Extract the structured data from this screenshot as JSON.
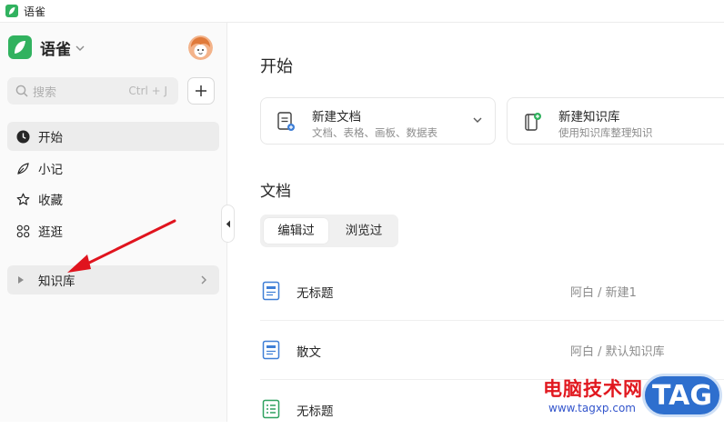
{
  "window": {
    "title": "语雀"
  },
  "sidebar": {
    "brand_name": "语雀",
    "search": {
      "placeholder": "搜索",
      "shortcut": "Ctrl + J"
    },
    "nav": [
      {
        "label": "开始",
        "icon": "clock-icon",
        "active": true
      },
      {
        "label": "小记",
        "icon": "feather-icon",
        "active": false
      },
      {
        "label": "收藏",
        "icon": "star-icon",
        "active": false
      },
      {
        "label": "逛逛",
        "icon": "grid-icon",
        "active": false
      }
    ],
    "knowledge_base": {
      "label": "知识库"
    }
  },
  "main": {
    "heading": "开始",
    "cards": [
      {
        "title": "新建文档",
        "subtitle": "文档、表格、画板、数据表",
        "icon": "new-doc-icon"
      },
      {
        "title": "新建知识库",
        "subtitle": "使用知识库整理知识",
        "icon": "new-repo-icon"
      }
    ],
    "docs_heading": "文档",
    "tabs": [
      {
        "label": "编辑过",
        "selected": true
      },
      {
        "label": "浏览过",
        "selected": false
      }
    ],
    "docs": [
      {
        "title": "无标题",
        "path": "阿白 / 新建1",
        "icon": "doc-icon"
      },
      {
        "title": "散文",
        "path": "阿白 / 默认知识库",
        "icon": "doc-icon"
      },
      {
        "title": "无标题",
        "path": "",
        "icon": "sheet-icon"
      }
    ]
  },
  "watermark": {
    "text": "电脑技术网",
    "url": "www.tagxp.com",
    "badge": "TAG"
  },
  "colors": {
    "brand_green": "#31b25f",
    "annotation_arrow": "#e0141e",
    "doc_icon_blue": "#3f7fd6",
    "sheet_icon_green": "#2fa160"
  }
}
